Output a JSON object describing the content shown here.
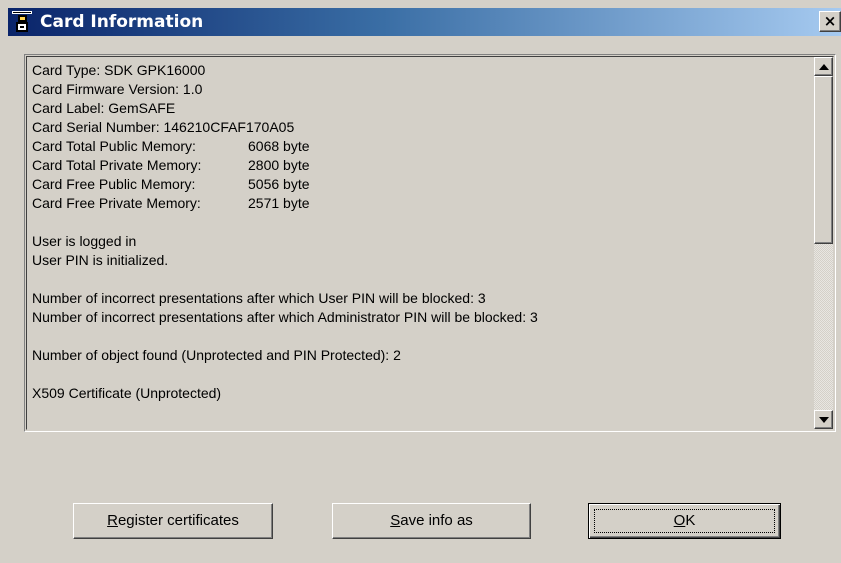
{
  "window": {
    "title": "Card Information",
    "close_label": "×"
  },
  "info_lines": [
    {
      "label": "Card Type: SDK GPK16000",
      "value": ""
    },
    {
      "label": "Card Firmware Version: 1.0",
      "value": ""
    },
    {
      "label": "Card Label: GemSAFE",
      "value": ""
    },
    {
      "label": "Card Serial Number: 146210CFAF170A05",
      "value": ""
    },
    {
      "label": "Card Total Public Memory:",
      "value": "6068 byte"
    },
    {
      "label": "Card Total Private Memory:",
      "value": "2800 byte"
    },
    {
      "label": "Card Free Public Memory:",
      "value": "5056 byte"
    },
    {
      "label": "Card Free Private Memory:",
      "value": "2571 byte"
    },
    {
      "label": "",
      "value": ""
    },
    {
      "label": "User is logged in",
      "value": ""
    },
    {
      "label": "User PIN is initialized.",
      "value": ""
    },
    {
      "label": "",
      "value": ""
    },
    {
      "label": "Number of incorrect presentations after which User PIN will be blocked: 3",
      "value": ""
    },
    {
      "label": "Number of incorrect presentations after which Administrator PIN will be blocked: 3",
      "value": ""
    },
    {
      "label": "",
      "value": ""
    },
    {
      "label": "Number of object found (Unprotected and PIN Protected): 2",
      "value": ""
    },
    {
      "label": "",
      "value": ""
    },
    {
      "label": "X509 Certificate (Unprotected)",
      "value": ""
    }
  ],
  "buttons": {
    "register": {
      "mnemonic": "R",
      "rest": "egister certificates"
    },
    "save": {
      "mnemonic": "S",
      "rest": "ave info as"
    },
    "ok": {
      "mnemonic": "O",
      "rest": "K"
    }
  },
  "icons": {
    "title_icon": "smartcard-reader-icon",
    "close": "close-icon",
    "scroll_up": "scroll-up-arrow-icon",
    "scroll_down": "scroll-down-arrow-icon"
  }
}
